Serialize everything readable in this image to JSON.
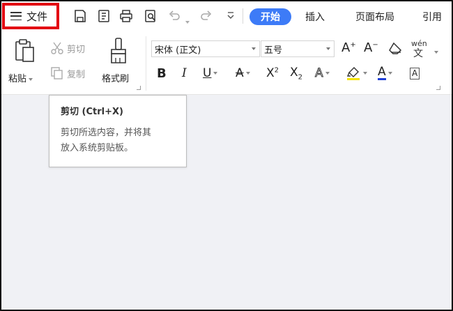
{
  "menubar": {
    "file_label": "文件",
    "tabs": [
      {
        "label": "开始",
        "active": true
      },
      {
        "label": "插入",
        "active": false
      },
      {
        "label": "页面布局",
        "active": false
      },
      {
        "label": "引用",
        "active": false
      }
    ]
  },
  "ribbon": {
    "paste_label": "粘贴",
    "cut_label": "剪切",
    "copy_label": "复制",
    "format_painter_label": "格式刷",
    "font_name": "宋体 (正文)",
    "font_size": "五号",
    "pinyin_glyph": "wén"
  },
  "tooltip": {
    "title": "剪切 (Ctrl+X)",
    "description_line1": "剪切所选内容，并将其",
    "description_line2": "放入系统剪贴板。"
  },
  "colors": {
    "accent": "#3d7bf7",
    "highlight_frame": "#e30613",
    "highlight_color": "#f5e400",
    "font_color": "#1f3fd8"
  }
}
